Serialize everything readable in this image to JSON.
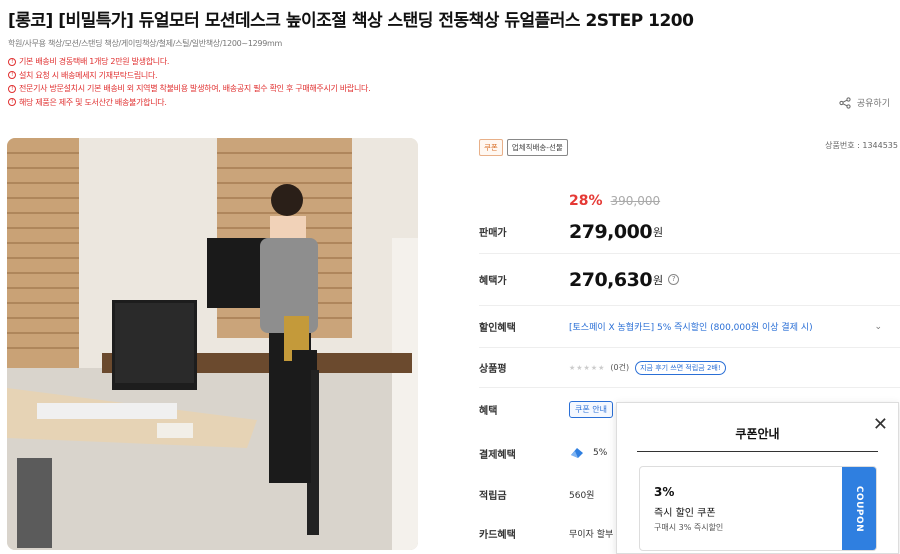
{
  "title": "[롱코] [비밀특가] 듀얼모터 모션데스크 높이조절 책상 스탠딩 전동책상 듀얼플러스 2STEP 1200",
  "categories": "학원/사무용 책상/모션/스탠딩 책상/게이밍책상/철제/스틸/일반책상/1200~1299mm",
  "notices": [
    "기본 배송비 경동택배 1개당 2만원 발생합니다.",
    "설치 요청 시 배송메세지 기재부탁드립니다.",
    "전문기사 방문설치시 기본 배송비 외 지역별 착불비용 발생하여, 배송공지 필수 확인 후 구매해주시기 바랍니다.",
    "해당 제품은 제주 및 도서산간 배송불가합니다."
  ],
  "share_label": "공유하기",
  "badges": {
    "coupon": "쿠폰",
    "shipping": "업체직배송-선물"
  },
  "product_code": "상품번호 : 1344535",
  "price": {
    "label": "판매가",
    "discount_rate": "28%",
    "original": "390,000",
    "sale": "279,000",
    "won": "원"
  },
  "benefit_price": {
    "label": "혜택가",
    "value": "270,630",
    "won": "원",
    "help": "?"
  },
  "discount_benefit": {
    "label": "할인혜택",
    "text": "[토스페이 X 농협카드] 5% 즉시할인 (800,000원 이상 결제 시)"
  },
  "review": {
    "label": "상품평",
    "stars": "★★★★★",
    "count": "(0건)",
    "tag": "지금 후기 쓰면 적립금 2배!"
  },
  "benefit": {
    "label": "혜택",
    "coupon_button": "쿠폰 안내"
  },
  "payment_benefit": {
    "label": "결제혜택",
    "value": "5%"
  },
  "points": {
    "label": "적립금",
    "value": "560원"
  },
  "card_benefit": {
    "label": "카드혜택",
    "value": "무이자 할부"
  },
  "coupon_popup": {
    "title": "쿠폰안내",
    "close": "✕",
    "coupon_rate": "3%",
    "coupon_name": "즉시 할인 쿠폰",
    "coupon_desc": "구매시 3% 즉시할인",
    "side_label": "COUPON"
  },
  "colors": {
    "discount_red": "#e53935",
    "link_blue": "#2a6fd6",
    "coupon_blue": "#2f7fe0"
  }
}
